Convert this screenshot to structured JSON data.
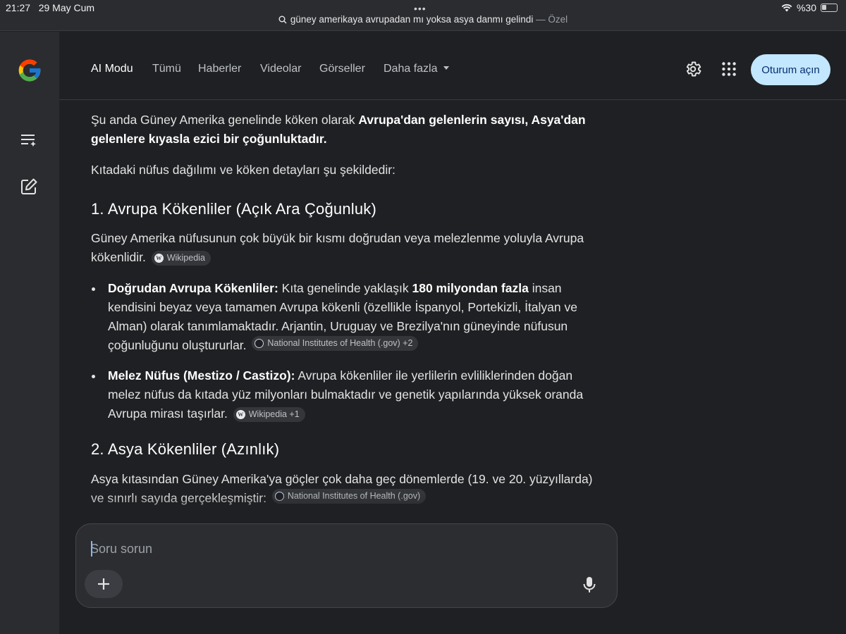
{
  "status_bar": {
    "time": "21:27",
    "date": "29 May Cum",
    "battery": "%30",
    "url": "güney amerikaya avrupadan mı yoksa asya danmı gelindi",
    "url_suffix": "— Özel"
  },
  "nav": {
    "tabs": [
      "AI Modu",
      "Tümü",
      "Haberler",
      "Videolar",
      "Görseller",
      "Daha fazla"
    ],
    "signin_label": "Oturum açın"
  },
  "icons": {
    "rail": [
      "google-logo",
      "history-list-icon",
      "new-chat-edit-icon"
    ],
    "nav": [
      "gear-icon",
      "apps-grid-icon"
    ],
    "input": [
      "plus-icon",
      "microphone-icon"
    ]
  },
  "colors": {
    "accent": "#c2e7ff",
    "background": "#1f2023",
    "surface": "#2b2c30"
  },
  "content": {
    "intro_1a": "Şu anda Güney Amerika genelinde köken olarak ",
    "intro_1b": "Avrupa'dan gelenlerin sayısı, Asya'dan gelenlere kıyasla ezici bir çoğunluktadır.",
    "intro_2": "Kıtadaki nüfus dağılımı ve köken detayları şu şekildedir:",
    "section_1_title": "1. Avrupa Kökenliler (Açık Ara Çoğunluk)",
    "section_1_text": "Güney Amerika nüfusunun çok büyük bir kısmı doğrudan veya melezlenme yoluyla Avrupa kökenlidir.",
    "section_1_chip": "Wikipedia",
    "bullet_1_title": "Doğrudan Avrupa Kökenliler:",
    "bullet_1_a": " Kıta genelinde yaklaşık ",
    "bullet_1_bold": "180 milyondan fazla",
    "bullet_1_b": " insan kendisini beyaz veya tamamen Avrupa kökenli (özellikle İspanyol, Portekizli, İtalyan ve Alman) olarak tanımlamaktadır. Arjantin, Uruguay ve Brezilya'nın güneyinde nüfusun çoğunluğunu oluştururlar.",
    "bullet_1_chip": "National Institutes of Health (.gov) +2",
    "bullet_2_title": "Melez Nüfus (Mestizo / Castizo):",
    "bullet_2_text": " Avrupa kökenliler ile yerlilerin evliliklerinden doğan melez nüfus da kıtada yüz milyonları bulmaktadır ve genetik yapılarında yüksek oranda Avrupa mirası taşırlar.",
    "bullet_2_chip": "Wikipedia +1",
    "section_2_title": "2. Asya Kökenliler (Azınlık)",
    "section_2_text": "Asya kıtasından Güney Amerika'ya göçler çok daha geç dönemlerde (19. ve 20. yüzyıllarda) ve sınırlı sayıda gerçekleşmiştir:",
    "section_2_chip": "National Institutes of Health (.gov)"
  },
  "input": {
    "placeholder": "Soru sorun",
    "value": ""
  }
}
